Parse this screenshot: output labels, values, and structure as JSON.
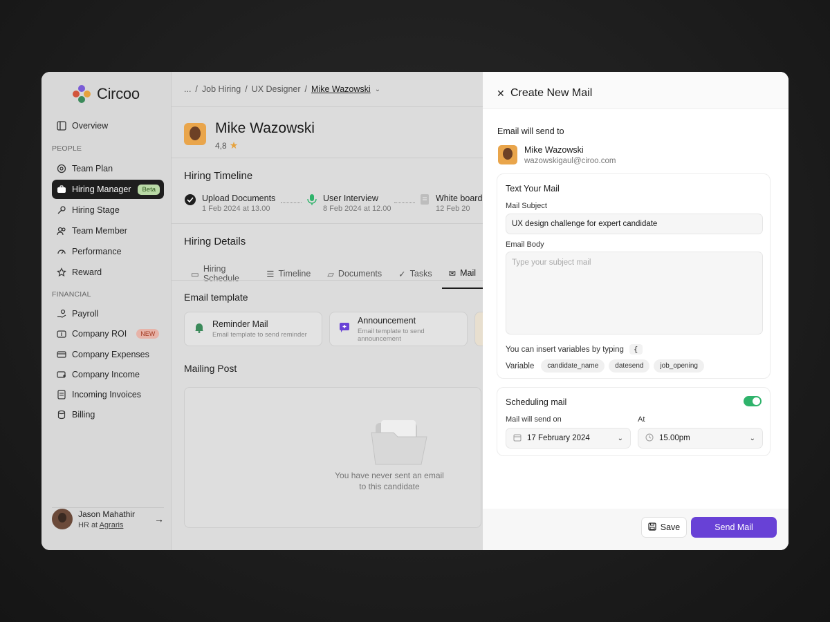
{
  "app": {
    "name": "Circoo"
  },
  "sidebar": {
    "overview": "Overview",
    "people_label": "PEOPLE",
    "people_items": [
      "Team Plan",
      "Hiring Manager",
      "Hiring Stage",
      "Team Member",
      "Performance",
      "Reward"
    ],
    "hiring_manager_badge": "Beta",
    "financial_label": "FINANCIAL",
    "financial_items": [
      "Payroll",
      "Company ROI",
      "Company Expenses",
      "Company Income",
      "Incoming Invoices",
      "Billing"
    ],
    "company_roi_badge": "NEW",
    "user": {
      "name": "Jason Mahathir",
      "role_prefix": "HR at",
      "company": "Agraris"
    }
  },
  "main": {
    "breadcrumb": [
      "...",
      "/",
      "Job Hiring",
      "/",
      "UX Designer",
      "/",
      "Mike Wazowski"
    ],
    "candidate": {
      "name": "Mike Wazowski",
      "rating": "4,8"
    },
    "timeline_title": "Hiring Timeline",
    "timeline": [
      {
        "title": "Upload Documents",
        "date": "1 Feb 2024 at 13.00"
      },
      {
        "title": "User Interview",
        "date": "8 Feb 2024 at 12.00"
      },
      {
        "title": "White board",
        "date": "12 Feb 20"
      }
    ],
    "details_title": "Hiring Details",
    "tabs": [
      "Hiring Schedule",
      "Timeline",
      "Documents",
      "Tasks",
      "Mail"
    ],
    "email_template_title": "Email template",
    "templates": [
      {
        "title": "Reminder Mail",
        "sub": "Email template to send reminder"
      },
      {
        "title": "Announcement",
        "sub": "Email template to send announcement"
      }
    ],
    "mailing_post_title": "Mailing Post",
    "empty_line1": "You have never sent an email",
    "empty_line2": "to this candidate"
  },
  "panel": {
    "title": "Create New Mail",
    "send_to_label": "Email will send to",
    "recipient": {
      "name": "Mike Wazowski",
      "email": "wazowskigaul@ciroo.com"
    },
    "text_section": "Text Your Mail",
    "subject_label": "Mail Subject",
    "subject_value": "UX design challenge for expert candidate",
    "body_label": "Email Body",
    "body_placeholder": "Type your subject mail",
    "variables_hint": "You can insert variables by typing",
    "variables_brace": "{",
    "variable_label": "Variable",
    "variables": [
      "candidate_name",
      "datesend",
      "job_opening"
    ],
    "scheduling_title": "Scheduling mail",
    "scheduling_enabled": true,
    "send_on_label": "Mail will send on",
    "send_on_value": "17 February 2024",
    "at_label": "At",
    "at_value": "15.00pm",
    "save_label": "Save",
    "send_label": "Send Mail"
  },
  "colors": {
    "accent": "#6841d6",
    "toggle_on": "#2fb36b",
    "badge_beta": "#b9d9a6",
    "badge_new": "#e7b3a8"
  }
}
